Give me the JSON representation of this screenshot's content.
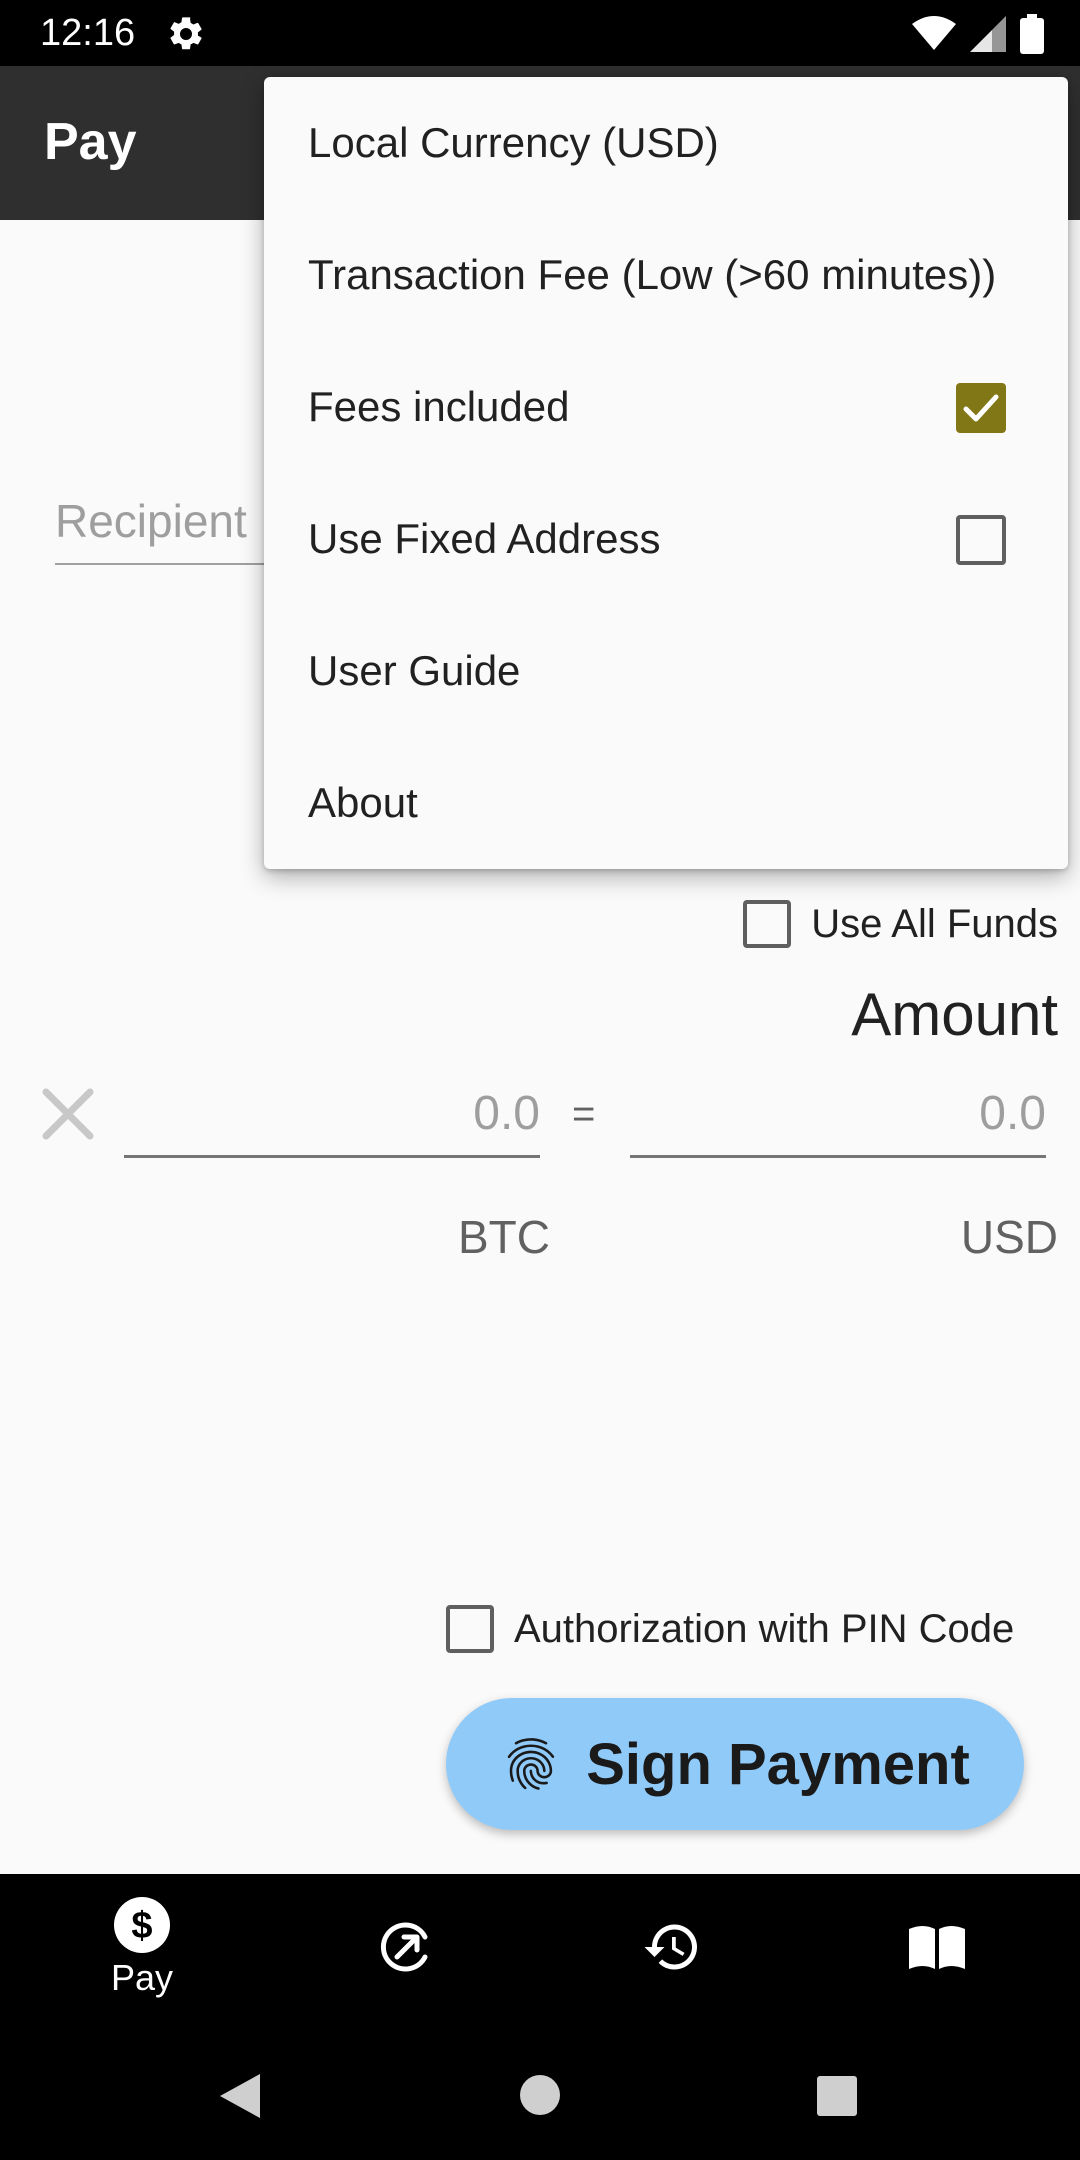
{
  "status_bar": {
    "time": "12:16"
  },
  "app_bar": {
    "title": "Pay"
  },
  "form": {
    "recipient_placeholder": "Recipient",
    "use_all_funds_label": "Use All Funds",
    "amount_title": "Amount",
    "btc_value": "0.0",
    "usd_value": "0.0",
    "equals": "=",
    "btc_label": "BTC",
    "usd_label": "USD",
    "pin_label": "Authorization with PIN Code",
    "sign_label": "Sign Payment"
  },
  "menu": {
    "items": [
      {
        "label": "Local Currency (USD)"
      },
      {
        "label": "Transaction Fee (Low (>60 minutes))"
      },
      {
        "label": "Fees included",
        "checked": true
      },
      {
        "label": "Use Fixed Address",
        "checked": false
      },
      {
        "label": "User Guide"
      },
      {
        "label": "About"
      }
    ]
  },
  "bottom_nav": {
    "items": [
      {
        "label": "Pay",
        "icon": "dollar-icon",
        "active": true
      },
      {
        "icon": "receive-icon"
      },
      {
        "icon": "history-icon"
      },
      {
        "icon": "book-icon"
      }
    ]
  },
  "colors": {
    "app_bar": "#2f2f2f",
    "sign_button": "#90caf9",
    "checkbox_checked": "#827717",
    "background": "#fafafa"
  }
}
